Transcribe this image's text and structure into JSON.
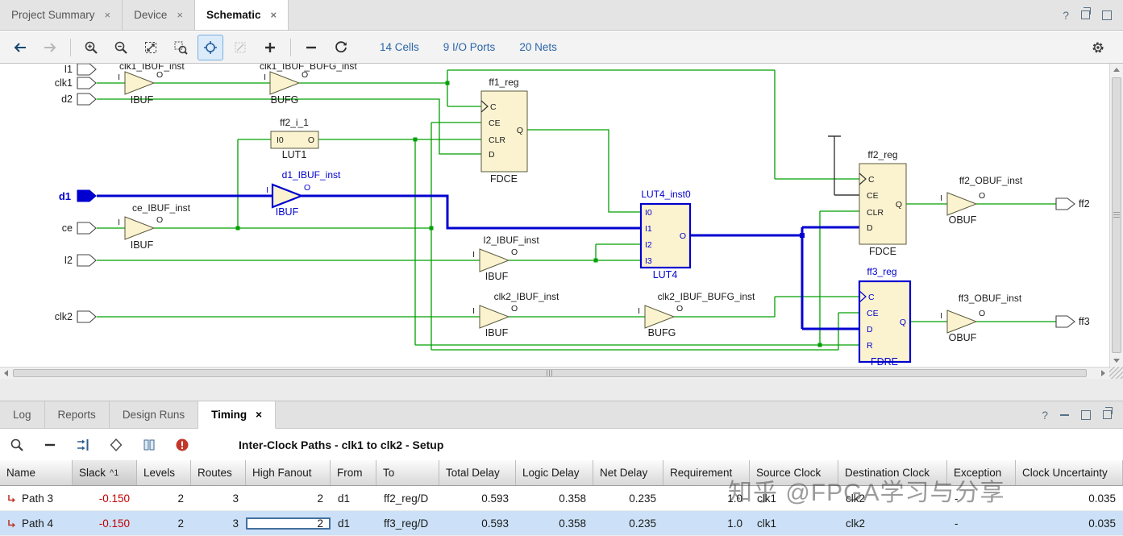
{
  "icons": {
    "close": "×",
    "help": "?"
  },
  "colors": {
    "net_green": "#00a000",
    "select_blue": "#0000d0",
    "slack_red": "#c40000",
    "link_blue": "#2b66a8"
  },
  "main_tabs": [
    {
      "label": "Project Summary"
    },
    {
      "label": "Device"
    },
    {
      "label": "Schematic",
      "active": true
    }
  ],
  "toolbar": {
    "cells": "14 Cells",
    "io_ports": "9 I/O Ports",
    "nets": "20 Nets"
  },
  "schematic": {
    "ports": {
      "i1": "I1",
      "clk1": "clk1",
      "d2": "d2",
      "d1": "d1",
      "ce": "ce",
      "i2": "I2",
      "clk2": "clk2",
      "ff2": "ff2",
      "ff3": "ff3"
    },
    "pins": {
      "c": "C",
      "ce": "CE",
      "clr": "CLR",
      "d": "D",
      "q": "Q",
      "r": "R",
      "i": "I",
      "o": "O",
      "i0": "I0",
      "i1": "I1",
      "i2": "I2",
      "i3": "I3"
    },
    "instances": {
      "clk1_ibuf": {
        "name": "clk1_IBUF_inst",
        "type": "IBUF"
      },
      "clk1_bufg": {
        "name": "clk1_IBUF_BUFG_inst",
        "type": "BUFG"
      },
      "ff1": {
        "name": "ff1_reg",
        "type": "FDCE"
      },
      "lut1": {
        "name": "ff2_i_1",
        "type": "LUT1"
      },
      "d1_ibuf": {
        "name": "d1_IBUF_inst",
        "type": "IBUF"
      },
      "ce_ibuf": {
        "name": "ce_IBUF_inst",
        "type": "IBUF"
      },
      "i2_ibuf": {
        "name": "I2_IBUF_inst",
        "type": "IBUF"
      },
      "lut4": {
        "name": "LUT4_inst0",
        "type": "LUT4"
      },
      "clk2_ibuf": {
        "name": "clk2_IBUF_inst",
        "type": "IBUF"
      },
      "clk2_bufg": {
        "name": "clk2_IBUF_BUFG_inst",
        "type": "BUFG"
      },
      "ff2": {
        "name": "ff2_reg",
        "type": "FDCE"
      },
      "ff3": {
        "name": "ff3_reg",
        "type": "FDRE"
      },
      "ff2_obuf": {
        "name": "ff2_OBUF_inst",
        "type": "OBUF"
      },
      "ff3_obuf": {
        "name": "ff3_OBUF_inst",
        "type": "OBUF"
      }
    }
  },
  "bottom_panel": {
    "tabs": [
      {
        "label": "Log"
      },
      {
        "label": "Reports"
      },
      {
        "label": "Design Runs"
      },
      {
        "label": "Timing",
        "active": true
      }
    ],
    "title": "Inter-Clock Paths - clk1 to clk2 - Setup",
    "sort": {
      "indicator": "^",
      "order": "1"
    },
    "table": {
      "columns": [
        "Name",
        "Slack",
        "Levels",
        "Routes",
        "High Fanout",
        "From",
        "To",
        "Total Delay",
        "Logic Delay",
        "Net Delay",
        "Requirement",
        "Source Clock",
        "Destination Clock",
        "Exception",
        "Clock Uncertainty"
      ],
      "rows": [
        {
          "name": "Path 3",
          "slack": "-0.150",
          "levels": "2",
          "routes": "3",
          "high_fanout": "2",
          "from": "d1",
          "to": "ff2_reg/D",
          "total_delay": "0.593",
          "logic_delay": "0.358",
          "net_delay": "0.235",
          "requirement": "1.0",
          "source_clock": "clk1",
          "destination_clock": "clk2",
          "exception": "-",
          "clock_uncertainty": "0.035"
        },
        {
          "name": "Path 4",
          "slack": "-0.150",
          "levels": "2",
          "routes": "3",
          "high_fanout": "2",
          "from": "d1",
          "to": "ff3_reg/D",
          "total_delay": "0.593",
          "logic_delay": "0.358",
          "net_delay": "0.235",
          "requirement": "1.0",
          "source_clock": "clk1",
          "destination_clock": "clk2",
          "exception": "-",
          "clock_uncertainty": "0.035"
        }
      ]
    },
    "watermark": "知乎 @FPGA学习与分享"
  }
}
